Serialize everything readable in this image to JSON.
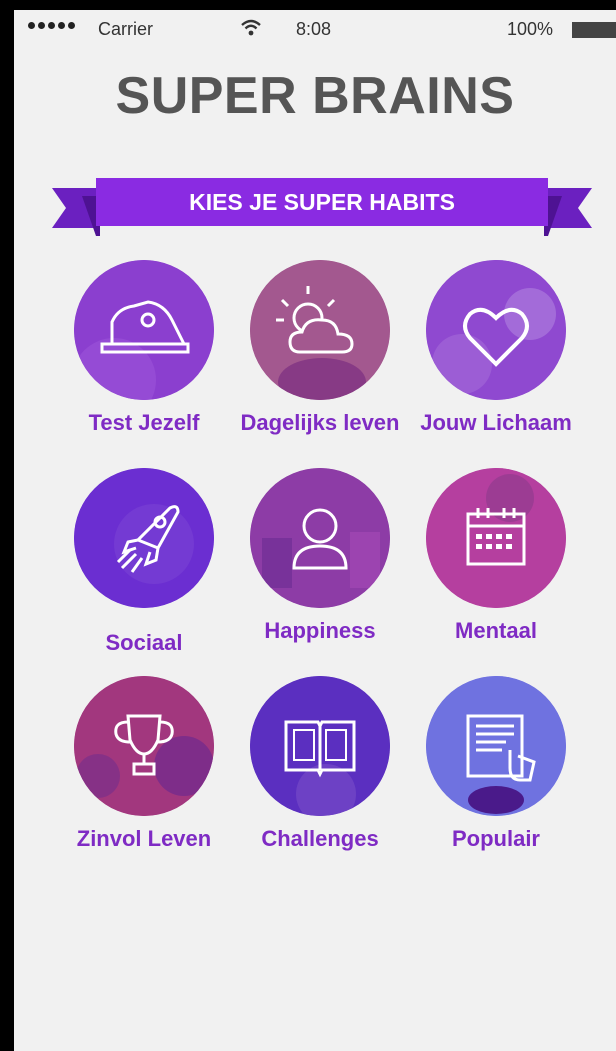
{
  "status_bar": {
    "carrier": "Carrier",
    "time": "8:08",
    "battery": "100%"
  },
  "app": {
    "title": "SUPER BRAINS"
  },
  "banner": {
    "text": "KIES JE SUPER HABITS",
    "color": "#8a2be2"
  },
  "habits": [
    {
      "label": "Test Jezelf",
      "icon": "scale-icon",
      "bg": "#8b3fcf"
    },
    {
      "label": "Dagelijks leven",
      "icon": "weather-icon",
      "bg": "#a3588f"
    },
    {
      "label": "Jouw Lichaam",
      "icon": "heart-icon",
      "bg": "#8f49d0"
    },
    {
      "label": "Sociaal",
      "icon": "rocket-icon",
      "bg": "#6b2ed1"
    },
    {
      "label": "Happiness",
      "icon": "person-icon",
      "bg": "#8d3ca6"
    },
    {
      "label": "Mentaal",
      "icon": "calendar-icon",
      "bg": "#b53f9f"
    },
    {
      "label": "Zinvol Leven",
      "icon": "trophy-icon",
      "bg": "#a2377e"
    },
    {
      "label": "Challenges",
      "icon": "book-icon",
      "bg": "#5b2fc0"
    },
    {
      "label": "Populair",
      "icon": "tablet-icon",
      "bg": "#6f72e0"
    }
  ]
}
